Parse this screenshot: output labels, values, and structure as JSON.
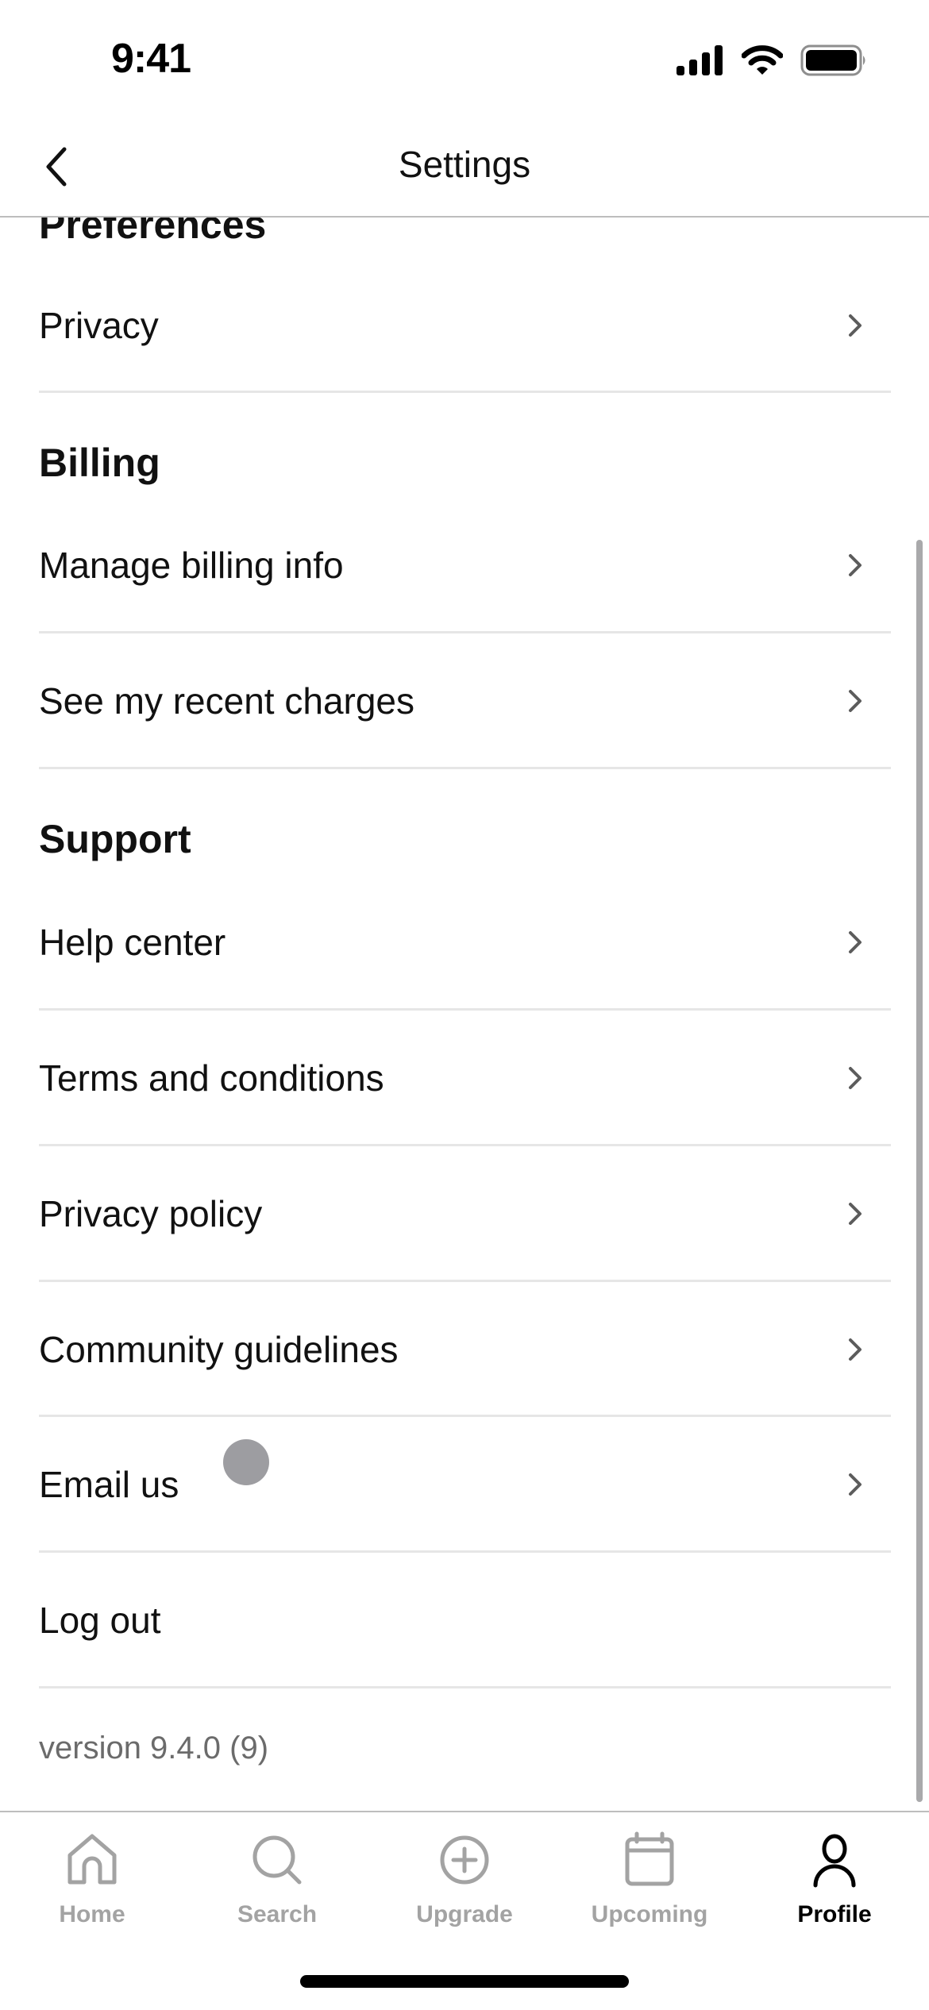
{
  "status_bar": {
    "time": "9:41",
    "icons": [
      "cellular-signal-icon",
      "wifi-icon",
      "battery-icon"
    ]
  },
  "nav": {
    "title": "Settings",
    "back_icon": "chevron-left-icon"
  },
  "sections": [
    {
      "heading": "Preferences",
      "items": [
        {
          "label": "Privacy",
          "chevron": true
        }
      ]
    },
    {
      "heading": "Billing",
      "items": [
        {
          "label": "Manage billing info",
          "chevron": true
        },
        {
          "label": "See my recent charges",
          "chevron": true
        }
      ]
    },
    {
      "heading": "Support",
      "items": [
        {
          "label": "Help center",
          "chevron": true
        },
        {
          "label": "Terms and conditions",
          "chevron": true
        },
        {
          "label": "Privacy policy",
          "chevron": true
        },
        {
          "label": "Community guidelines",
          "chevron": true
        },
        {
          "label": "Email us",
          "chevron": true
        },
        {
          "label": "Log out",
          "chevron": false
        }
      ]
    }
  ],
  "version": "version 9.4.0 (9)",
  "tabbar": {
    "tabs": [
      {
        "label": "Home",
        "icon": "home-icon",
        "active": false
      },
      {
        "label": "Search",
        "icon": "search-icon",
        "active": false
      },
      {
        "label": "Upgrade",
        "icon": "plus-circle-icon",
        "active": false
      },
      {
        "label": "Upcoming",
        "icon": "calendar-icon",
        "active": false
      },
      {
        "label": "Profile",
        "icon": "person-icon",
        "active": true
      }
    ]
  },
  "colors": {
    "text_primary": "#111111",
    "text_secondary": "#6b6b6b",
    "chevron": "#5c5c5c",
    "divider": "#e6e6e6",
    "tab_inactive": "#a3a3a3",
    "tab_active": "#000000"
  }
}
